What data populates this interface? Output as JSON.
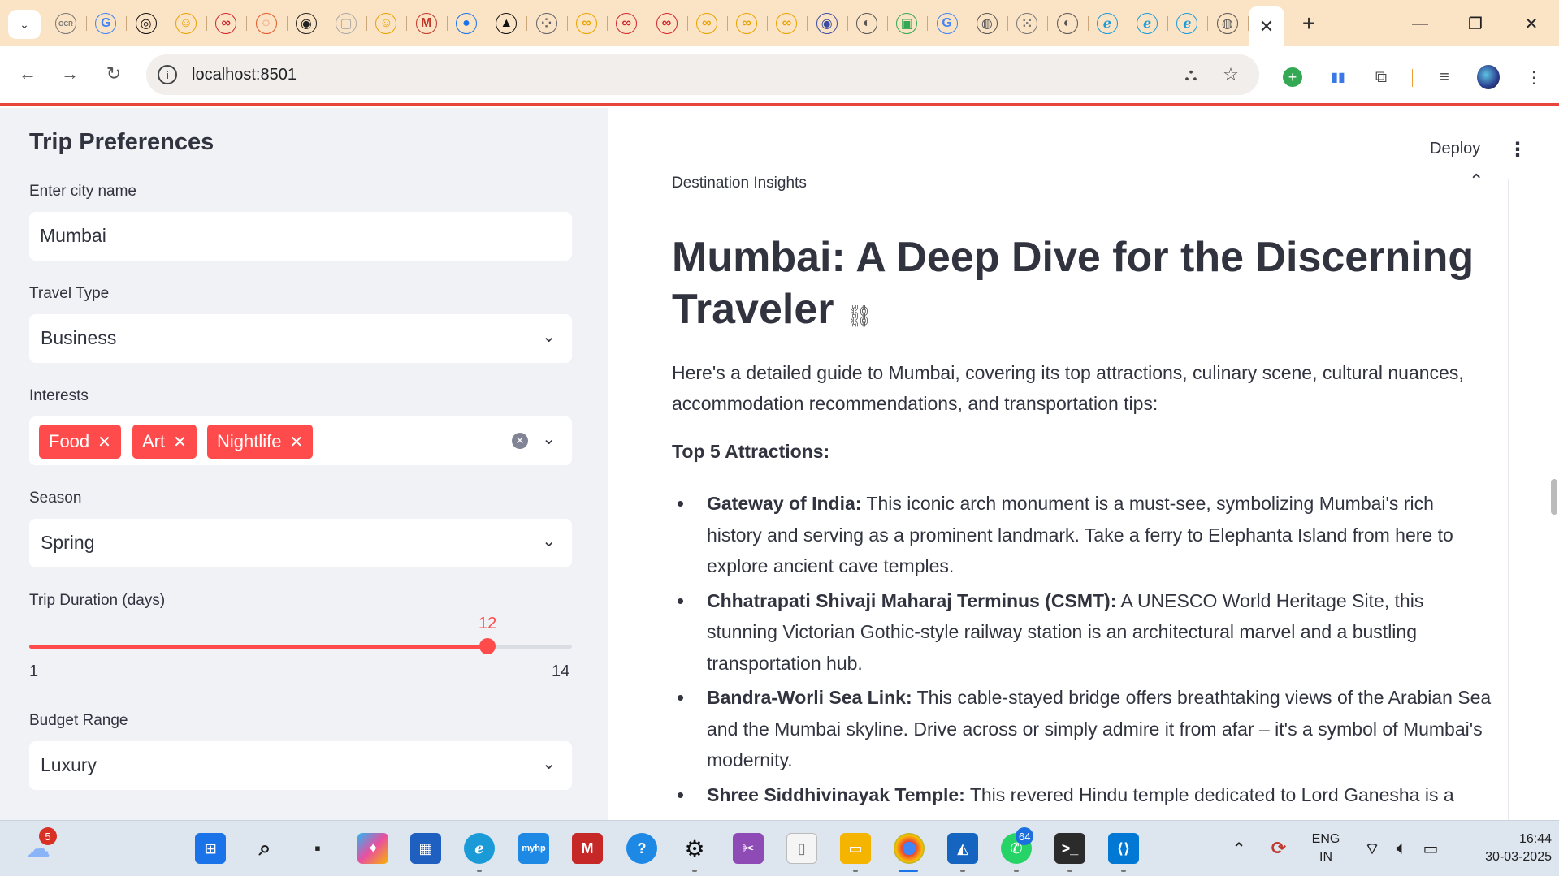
{
  "browser": {
    "tab_favicons": [
      {
        "name": "ocr-tab-icon",
        "glyph": "OCR",
        "color": "#777"
      },
      {
        "name": "google-tab-icon",
        "glyph": "G",
        "color": "#4285f4"
      },
      {
        "name": "openai-tab-icon",
        "glyph": "◎",
        "color": "#111"
      },
      {
        "name": "huggingface-tab-icon",
        "glyph": "☺",
        "color": "#e8a400"
      },
      {
        "name": "infinity-tab-icon",
        "glyph": "∞",
        "color": "#d0282e"
      },
      {
        "name": "swirl-tab-icon",
        "glyph": "◌",
        "color": "#e25a2b"
      },
      {
        "name": "github-tab-icon",
        "glyph": "◉",
        "color": "#222"
      },
      {
        "name": "cube-tab-icon",
        "glyph": "▢",
        "color": "#aaa"
      },
      {
        "name": "huggingface-tab-icon-2",
        "glyph": "☺",
        "color": "#e8a400"
      },
      {
        "name": "m-logo-tab-icon",
        "glyph": "M",
        "color": "#c0392b"
      },
      {
        "name": "blue-dot-tab-icon",
        "glyph": "●",
        "color": "#1a73e8"
      },
      {
        "name": "triangle-tab-icon",
        "glyph": "▲",
        "color": "#111"
      },
      {
        "name": "dots-tab-icon",
        "glyph": "⁘",
        "color": "#5f6368"
      },
      {
        "name": "infinity-tab-icon-2",
        "glyph": "∞",
        "color": "#e8a400"
      },
      {
        "name": "infinity-tab-icon-3",
        "glyph": "∞",
        "color": "#d0282e"
      },
      {
        "name": "infinity-tab-icon-4",
        "glyph": "∞",
        "color": "#d0282e"
      },
      {
        "name": "infinity-tab-icon-5",
        "glyph": "∞",
        "color": "#e8a400"
      },
      {
        "name": "infinity-tab-icon-6",
        "glyph": "∞",
        "color": "#e8a400"
      },
      {
        "name": "infinity-tab-icon-7",
        "glyph": "∞",
        "color": "#e8a400"
      },
      {
        "name": "circle-tab-icon",
        "glyph": "◉",
        "color": "#3c4ea0"
      },
      {
        "name": "globe-tab-icon",
        "glyph": "◐",
        "color": "#555"
      },
      {
        "name": "meet-tab-icon",
        "glyph": "▣",
        "color": "#34a853"
      },
      {
        "name": "google-tab-icon-2",
        "glyph": "G",
        "color": "#4285f4"
      },
      {
        "name": "chrome-tab-icon",
        "glyph": "◍",
        "color": "#555"
      },
      {
        "name": "grid-tab-icon",
        "glyph": "⁙",
        "color": "#777"
      },
      {
        "name": "globe-tab-icon-2",
        "glyph": "◐",
        "color": "#555"
      },
      {
        "name": "edge-tab-icon",
        "glyph": "ℯ",
        "color": "#1a9bd7"
      },
      {
        "name": "edge-tab-icon-2",
        "glyph": "ℯ",
        "color": "#1a9bd7"
      },
      {
        "name": "edge-tab-icon-3",
        "glyph": "ℯ",
        "color": "#1a9bd7"
      },
      {
        "name": "chrome-tab-icon-2",
        "glyph": "◍",
        "color": "#555"
      }
    ],
    "url": "localhost:8501"
  },
  "sidebar": {
    "title": "Trip Preferences",
    "city_label": "Enter city name",
    "city_value": "Mumbai",
    "travel_type_label": "Travel Type",
    "travel_type_value": "Business",
    "interests_label": "Interests",
    "interests": [
      "Food",
      "Art",
      "Nightlife"
    ],
    "season_label": "Season",
    "season_value": "Spring",
    "duration_label": "Trip Duration (days)",
    "duration_value": "12",
    "duration_min": "1",
    "duration_max": "14",
    "budget_label": "Budget Range",
    "budget_value": "Luxury"
  },
  "header": {
    "deploy_label": "Deploy"
  },
  "main": {
    "expander_title": "Destination Insights",
    "heading": "Mumbai: A Deep Dive for the Discerning Traveler",
    "intro": "Here's a detailed guide to Mumbai, covering its top attractions, culinary scene, cultural nuances, accommodation recommendations, and transportation tips:",
    "subheading": "Top 5 Attractions:",
    "attractions": [
      {
        "name": "Gateway of India:",
        "text": " This iconic arch monument is a must-see, symbolizing Mumbai's rich history and serving as a prominent landmark. Take a ferry to Elephanta Island from here to explore ancient cave temples."
      },
      {
        "name": "Chhatrapati Shivaji Maharaj Terminus (CSMT):",
        "text": " A UNESCO World Heritage Site, this stunning Victorian Gothic-style railway station is an architectural marvel and a bustling transportation hub."
      },
      {
        "name": "Bandra-Worli Sea Link:",
        "text": " This cable-stayed bridge offers breathtaking views of the Arabian Sea and the Mumbai skyline. Drive across or simply admire it from afar – it's a symbol of Mumbai's modernity."
      },
      {
        "name": "Shree Siddhivinayak Temple:",
        "text": " This revered Hindu temple dedicated to Lord Ganesha is a"
      }
    ]
  },
  "taskbar": {
    "weather_badge": "5",
    "whatsapp_badge": "64",
    "lang_top": "ENG",
    "lang_bottom": "IN",
    "time": "16:44",
    "date": "30-03-2025"
  },
  "colors": {
    "accent": "#ff4b4b",
    "sidebar_bg": "#f0f2f6",
    "tabstrip_bg": "#fbe3c5"
  }
}
